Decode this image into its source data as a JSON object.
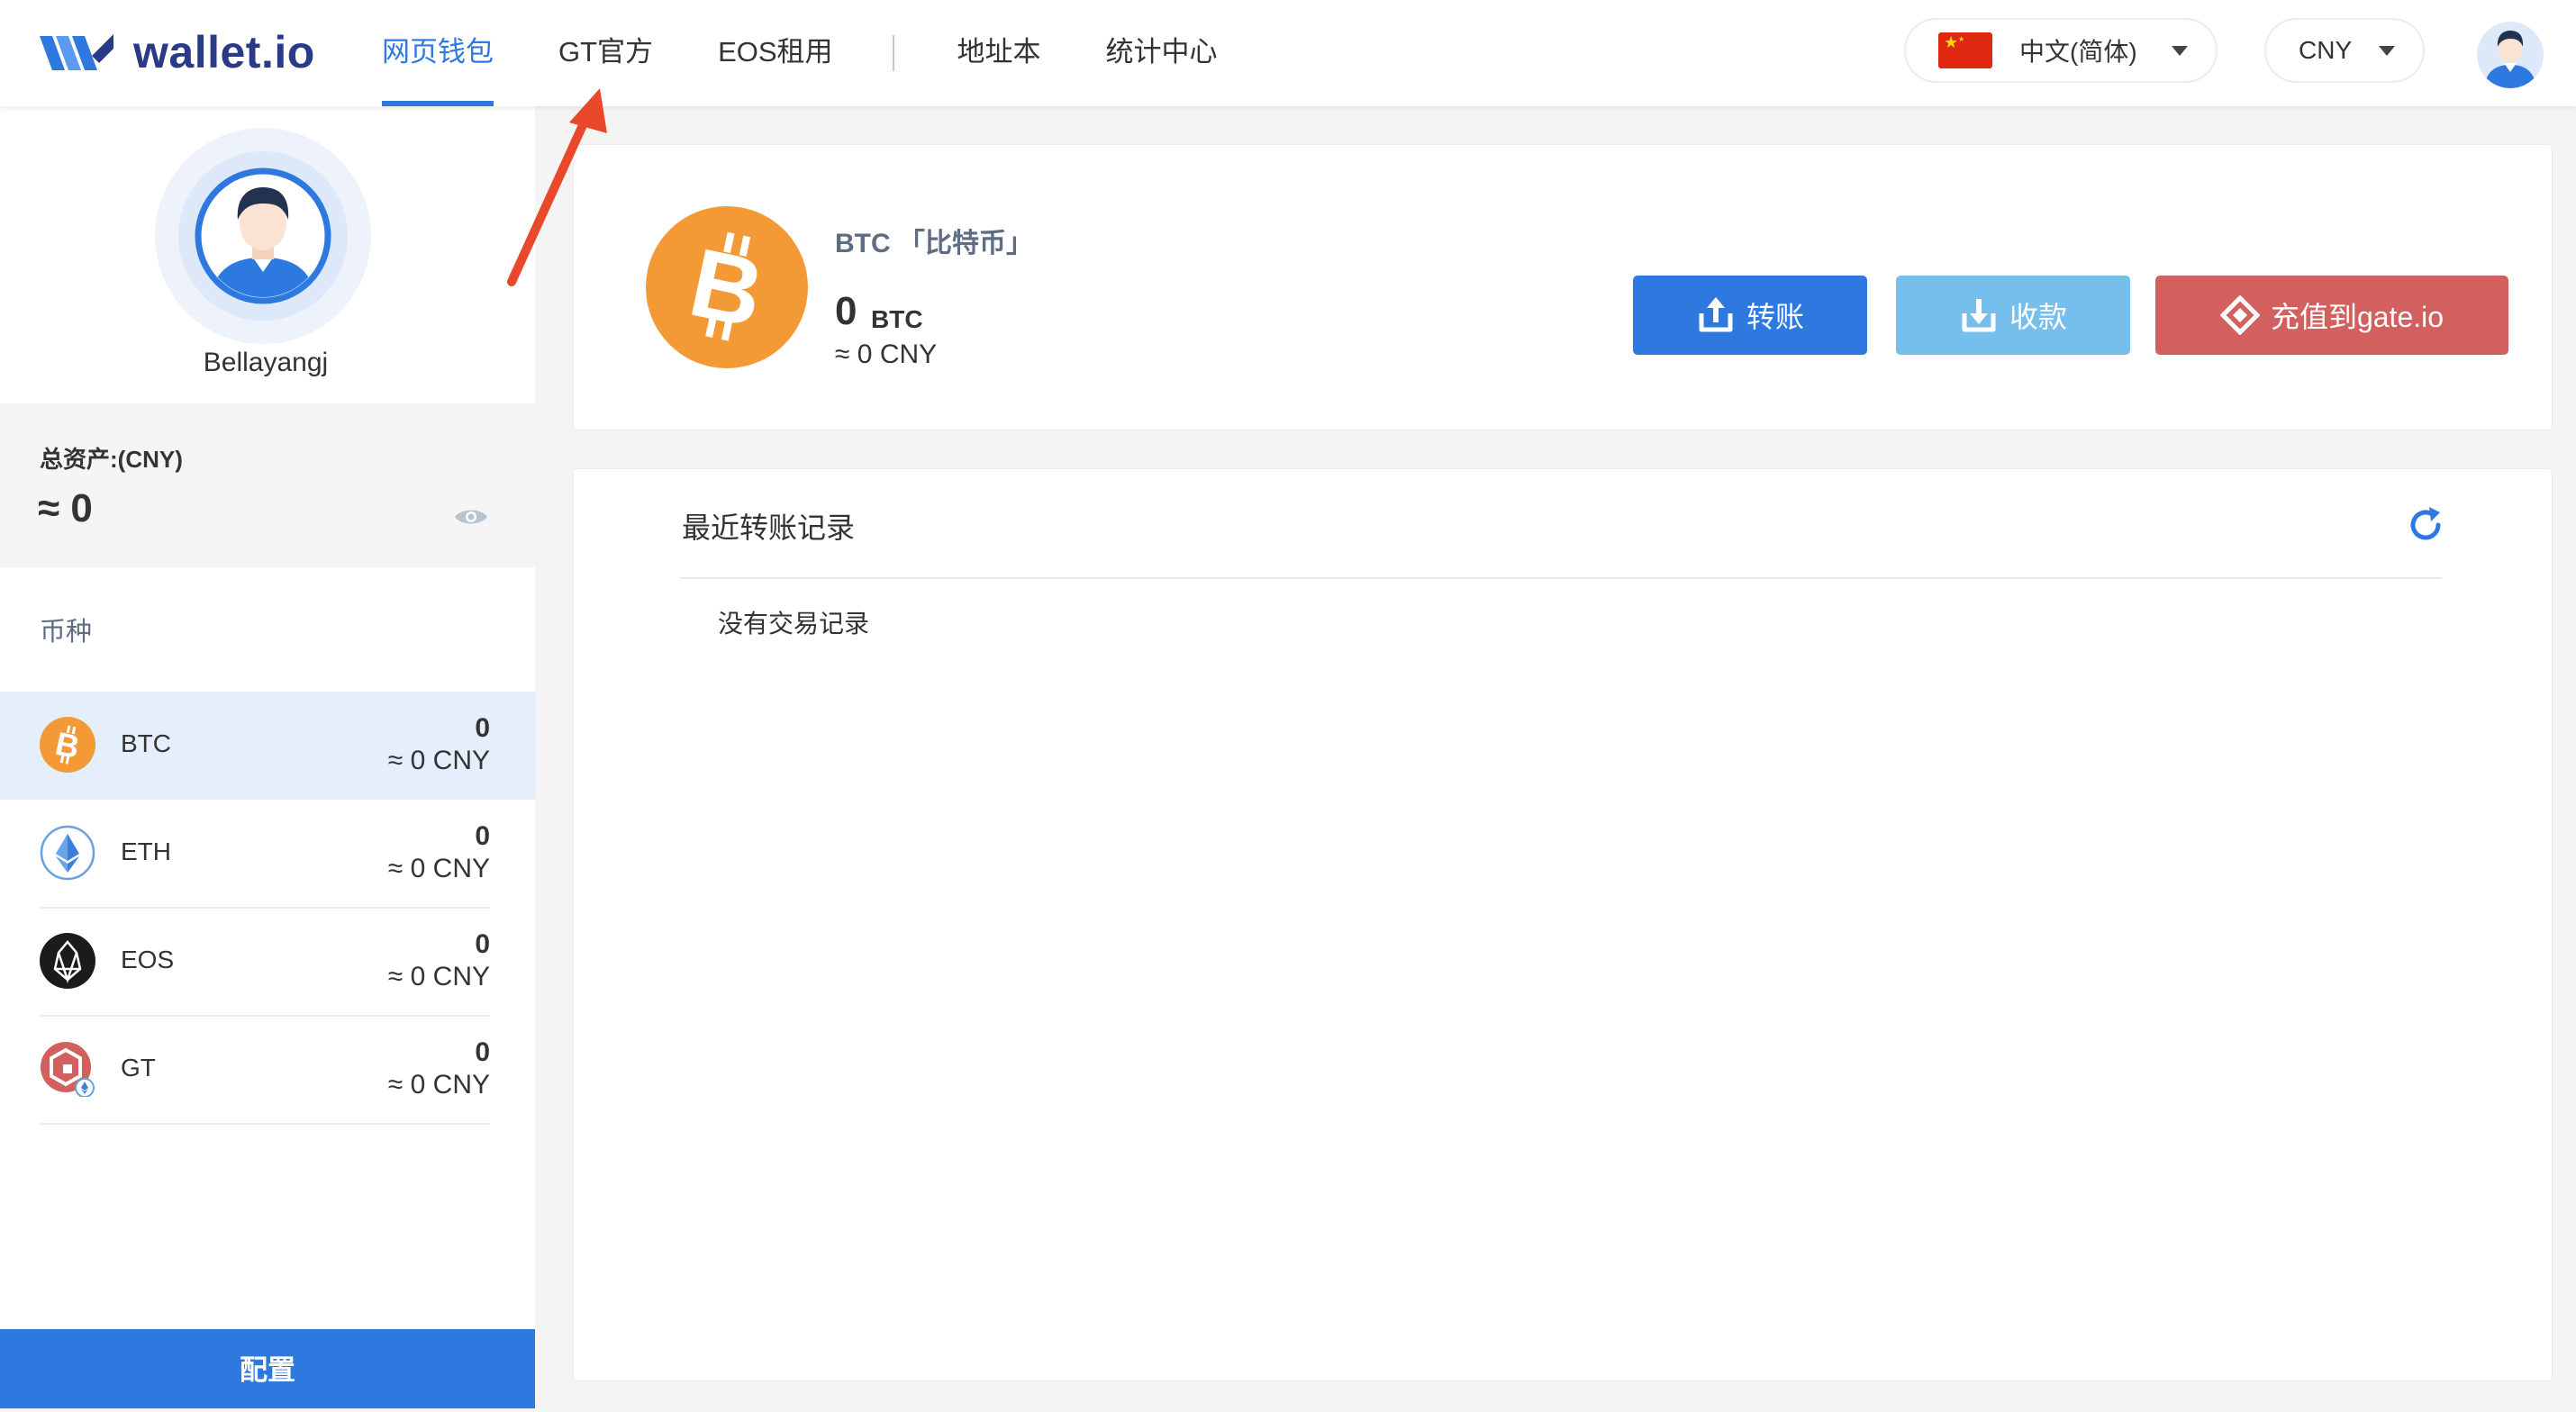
{
  "header": {
    "logo_text": "wallet.io",
    "nav": [
      {
        "label": "网页钱包",
        "active": true
      },
      {
        "label": "GT官方"
      },
      {
        "label": "EOS租用"
      },
      {
        "label": "地址本"
      },
      {
        "label": "统计中心"
      }
    ],
    "language": "中文(简体)",
    "currency": "CNY",
    "accent_color": "#2d79df"
  },
  "sidebar": {
    "username": "Bellayangj",
    "assets_label": "总资产:(CNY)",
    "assets_value": "≈ 0",
    "coins_title": "币种",
    "coins": [
      {
        "symbol": "BTC",
        "amount": "0",
        "cny": "≈ 0 CNY",
        "icon": "bitcoin-icon",
        "selected": true
      },
      {
        "symbol": "ETH",
        "amount": "0",
        "cny": "≈ 0 CNY",
        "icon": "ethereum-icon"
      },
      {
        "symbol": "EOS",
        "amount": "0",
        "cny": "≈ 0 CNY",
        "icon": "eos-icon"
      },
      {
        "symbol": "GT",
        "amount": "0",
        "cny": "≈ 0 CNY",
        "icon": "gatetoken-icon"
      }
    ],
    "config_label": "配置"
  },
  "coin_card": {
    "name": "BTC 「比特币」",
    "amount": "0",
    "unit": "BTC",
    "cny": "≈ 0 CNY",
    "buttons": {
      "transfer": "转账",
      "receive": "收款",
      "deposit_gate": "充值到gate.io"
    },
    "button_colors": {
      "transfer": "#2d79df",
      "receive": "#76bfec",
      "deposit_gate": "#d2605f"
    }
  },
  "records": {
    "title": "最近转账记录",
    "empty_text": "没有交易记录"
  }
}
